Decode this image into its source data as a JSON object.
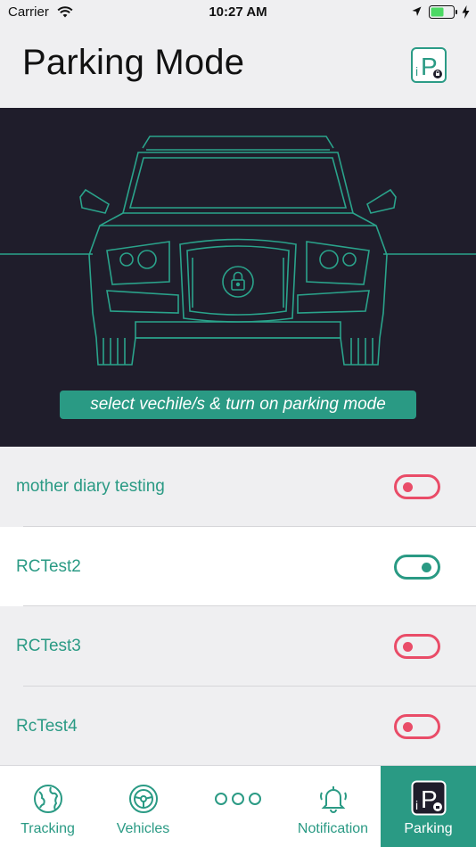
{
  "status_bar": {
    "carrier": "Carrier",
    "time": "10:27 AM"
  },
  "header": {
    "title": "Parking Mode",
    "logo_letters": "iP"
  },
  "hero": {
    "banner_text": "select vechile/s & turn on parking mode"
  },
  "vehicles": [
    {
      "name": "mother diary testing",
      "parking_on": false
    },
    {
      "name": "RCTest2",
      "parking_on": true
    },
    {
      "name": "RCTest3",
      "parking_on": false
    },
    {
      "name": "RcTest4",
      "parking_on": false
    }
  ],
  "tabs": [
    {
      "label": "Tracking",
      "icon": "globe-icon"
    },
    {
      "label": "Vehicles",
      "icon": "steering-wheel-icon"
    },
    {
      "label": "",
      "icon": "more-dots-icon"
    },
    {
      "label": "Notification",
      "icon": "bell-icon"
    },
    {
      "label": "Parking",
      "icon": "parking-icon",
      "selected": true
    }
  ],
  "colors": {
    "accent": "#2a9a84",
    "toggle_off": "#e94c68",
    "hero_bg": "#1f1d2b",
    "background": "#efeff1"
  }
}
